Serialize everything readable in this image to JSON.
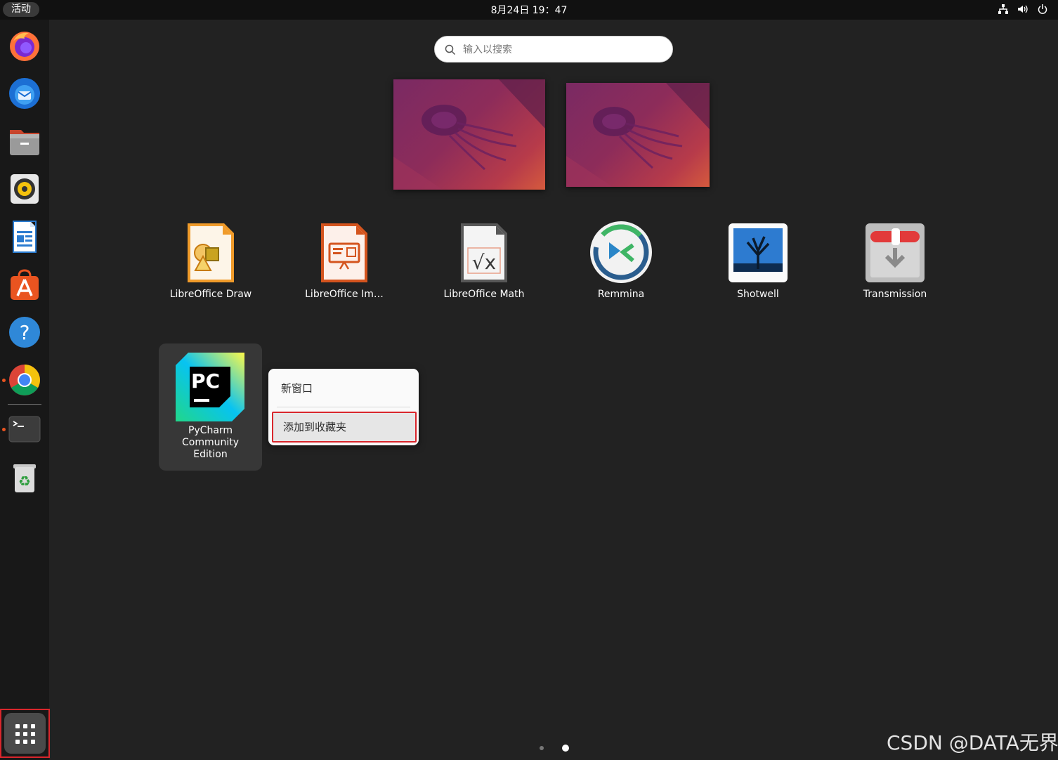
{
  "topbar": {
    "activities": "活动",
    "clock": "8月24日 19：47",
    "tray": [
      "network-icon",
      "volume-icon",
      "power-icon"
    ]
  },
  "dock": {
    "items": [
      {
        "name": "firefox",
        "icon": "firefox-icon",
        "running": false
      },
      {
        "name": "thunderbird",
        "icon": "thunderbird-icon",
        "running": false
      },
      {
        "name": "files",
        "icon": "files-icon",
        "running": false
      },
      {
        "name": "rhythmbox",
        "icon": "rhythmbox-icon",
        "running": false
      },
      {
        "name": "libreoffice-writer",
        "icon": "writer-icon",
        "running": false
      },
      {
        "name": "app-center",
        "icon": "app-store-icon",
        "running": false
      },
      {
        "name": "help",
        "icon": "help-icon",
        "running": false
      },
      {
        "name": "chrome",
        "icon": "chrome-icon",
        "running": true
      },
      {
        "name": "terminal",
        "icon": "terminal-icon",
        "running": true
      },
      {
        "name": "trash",
        "icon": "trash-icon",
        "running": false
      }
    ],
    "show_apps": "show-apps-grid-icon"
  },
  "search": {
    "placeholder": "输入以搜索",
    "value": ""
  },
  "apps": [
    {
      "label": "LibreOffice Draw",
      "icon": "libreoffice-draw-icon"
    },
    {
      "label": "LibreOffice Im…",
      "icon": "libreoffice-impress-icon"
    },
    {
      "label": "LibreOffice Math",
      "icon": "libreoffice-math-icon"
    },
    {
      "label": "Remmina",
      "icon": "remmina-icon"
    },
    {
      "label": "Shotwell",
      "icon": "shotwell-icon"
    },
    {
      "label": "Transmission",
      "icon": "transmission-icon"
    }
  ],
  "pycharm": {
    "icon_text": "PC",
    "label_lines": [
      "PyCharm",
      "Community",
      "Edition"
    ]
  },
  "context_menu": {
    "new_window": "新窗口",
    "add_to_favorites": "添加到收藏夹"
  },
  "pages": {
    "count": 2,
    "current": 2
  },
  "watermark": "CSDN @DATA无界",
  "colors": {
    "accent": "#e95420",
    "highlight_border": "#d9262c",
    "background": "#222222"
  }
}
